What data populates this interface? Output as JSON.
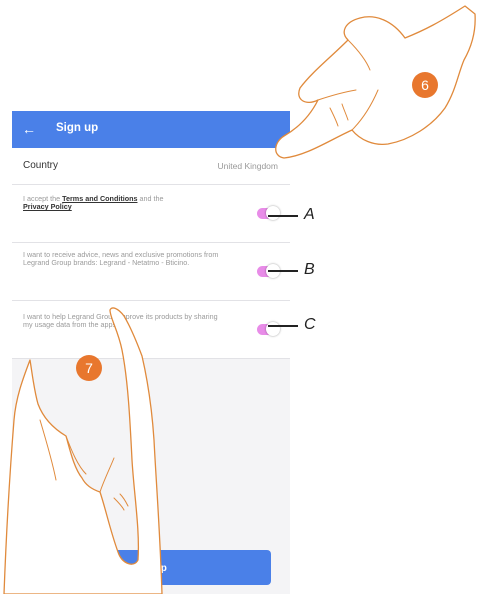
{
  "appbar": {
    "back_icon": "←",
    "title": "Sign up"
  },
  "country": {
    "label": "Country",
    "value": "United Kingdom"
  },
  "consents": [
    {
      "prefix": "I accept the ",
      "link1": "Terms and Conditions",
      "middle": " and the ",
      "link2": "Privacy Policy",
      "enabled": true,
      "callout": "A"
    },
    {
      "text": "I want to receive advice, news and exclusive promotions from Legrand Group brands: Legrand - Netatmo - Bticino.",
      "enabled": true,
      "callout": "B"
    },
    {
      "text": "I want to help Legrand Group improve its products by sharing my usage data from the apps.",
      "enabled": true,
      "callout": "C"
    }
  ],
  "signup_button": "Sign up",
  "steps": {
    "top": "6",
    "bottom": "7"
  },
  "colors": {
    "accent": "#4a80e8",
    "toggle_on": "#e88ce8",
    "badge": "#e8772e",
    "hand_outline": "#e08a3c"
  }
}
